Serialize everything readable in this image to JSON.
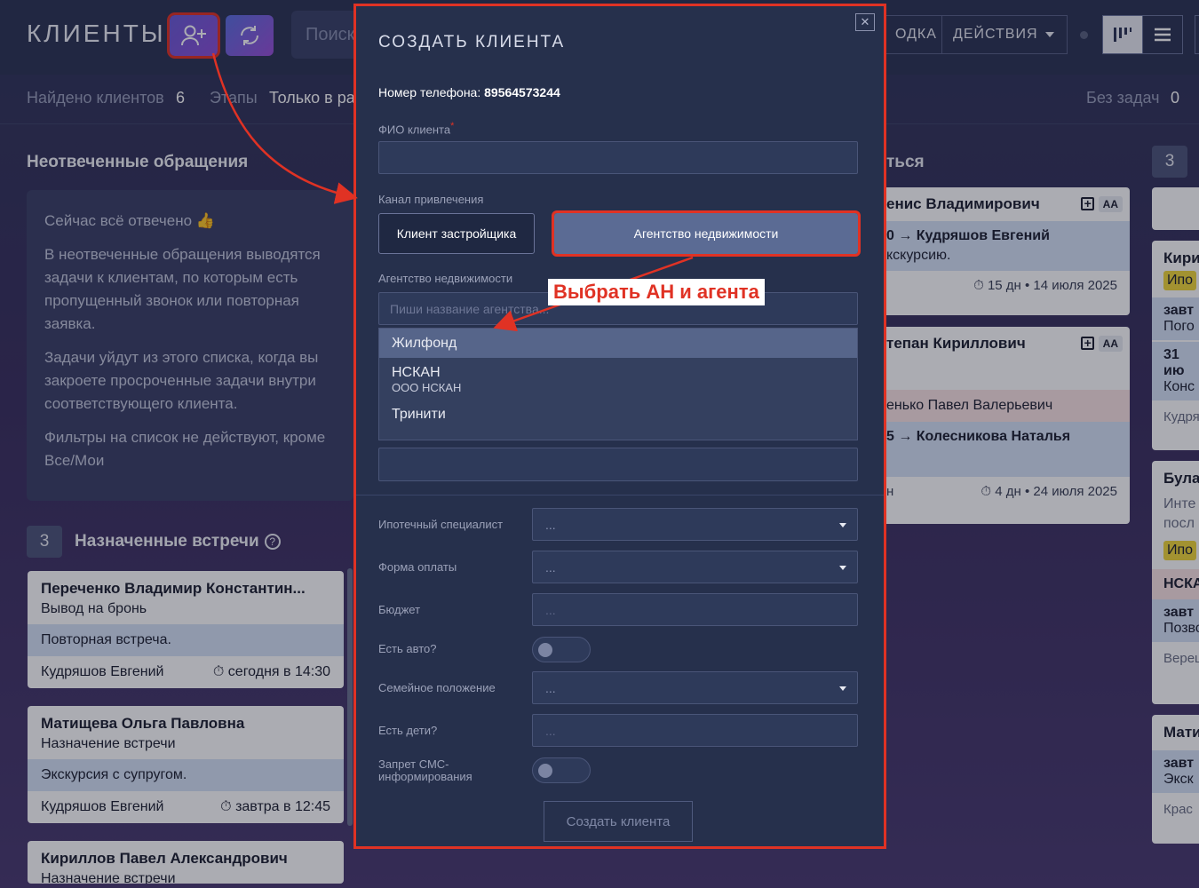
{
  "header": {
    "title": "КЛИЕНТЫ",
    "search_placeholder": "Поиск",
    "btn_summary": "ОДКА",
    "btn_actions": "ДЕЙСТВИЯ"
  },
  "subbar": {
    "found_label": "Найдено клиентов",
    "found_count": "6",
    "stages_label": "Этапы",
    "stages_value": "Только в ра",
    "no_tasks_label": "Без задач",
    "no_tasks_count": "0"
  },
  "unanswered": {
    "title": "Неотвеченные обращения",
    "p1": "Сейчас всё отвечено 👍",
    "p2": "В неотвеченные обращения выводятся задачи к клиентам, по которым есть пропущенный звонок или повторная заявка.",
    "p3": "Задачи уйдут из этого списка, когда вы закроете просроченные задачи внутри соответствующего клиента.",
    "p4": "Фильтры на список не действуют, кроме Все/Мои"
  },
  "meetings": {
    "count": "3",
    "title": "Назначенные встречи",
    "help": "?",
    "cards": [
      {
        "name": "Переченко Владимир Константин...",
        "type": "Вывод на бронь",
        "note": "Повторная встреча.",
        "agent": "Кудряшов Евгений",
        "time": "сегодня в 14:30"
      },
      {
        "name": "Матищева Ольга Павловна",
        "type": "Назначение встречи",
        "note": "Экскурсия с супругом.",
        "agent": "Кудряшов Евгений",
        "time": "завтра в 12:45"
      },
      {
        "name": "Кириллов Павел Александрович",
        "type": "Назначение встречи"
      }
    ]
  },
  "middle_column": {
    "title": "ться",
    "cards": [
      {
        "name": "енис Владимирович",
        "aa": "АА",
        "route": "0 → Кудряшов Евгений",
        "note": "кскурсию.",
        "meta": "15 дн • 14 июля 2025"
      },
      {
        "name": "тепан Кириллович",
        "aa": "АА",
        "pink": "енько Павел Валерьевич",
        "route": "5 → Колесникова Наталья",
        "meta_prefix": "н",
        "meta": "4 дн • 24 июля 2025"
      }
    ]
  },
  "right_column": {
    "count": "3",
    "cards": [
      "Кири",
      "Ипо",
      "завт",
      "Пого",
      "31 ию",
      "Конс",
      "Кудря",
      "Була",
      "Инте",
      "посл",
      "Ипо",
      "НСКА",
      "завт",
      "Позво",
      "Верец",
      "Мати",
      "завт",
      "Экск",
      "Крас"
    ]
  },
  "modal": {
    "title": "СОЗДАТЬ КЛИЕНТА",
    "close": "✕",
    "phone_label": "Номер телефона:",
    "phone_value": "89564573244",
    "fio_label": "ФИО клиента",
    "fio_req": "*",
    "channel_label": "Канал привлечения",
    "channel_developer": "Клиент застройщика",
    "channel_agency": "Агентство недвижимости",
    "agency_label": "Агентство недвижимости",
    "agency_placeholder": "Пиши название агентства...",
    "dropdown": [
      {
        "name": "Жилфонд"
      },
      {
        "name": "НСКАН",
        "sub": "ООО НСКАН"
      },
      {
        "name": "Тринити"
      }
    ],
    "mortgage_label": "Ипотечный специалист",
    "mortgage_value": "...",
    "payment_label": "Форма оплаты",
    "payment_value": "...",
    "budget_label": "Бюджет",
    "budget_placeholder": "...",
    "car_label": "Есть авто?",
    "family_label": "Семейное положение",
    "family_value": "...",
    "kids_label": "Есть дети?",
    "kids_placeholder": "...",
    "sms_label": "Запрет СМС-информирования",
    "submit": "Создать клиента"
  },
  "annotation": {
    "callout": "Выбрать АН и агента",
    "color": "#e03224"
  }
}
